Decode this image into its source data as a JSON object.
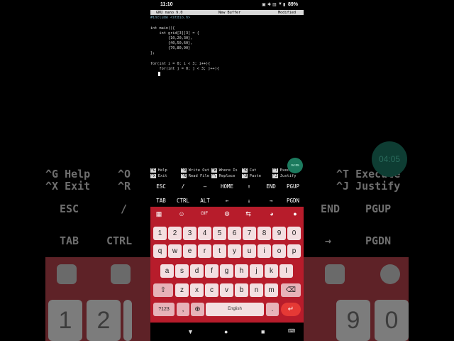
{
  "status": {
    "time": "11:10",
    "battery": "89%"
  },
  "nano": {
    "app": "GNU nano 9.0",
    "buffer": "New Buffer",
    "state": "Modified",
    "lines": [
      "#include <stdio.h>",
      "",
      "int main(){",
      "    int grid[3][3] = {",
      "        {10,20,30},",
      "        {40,50,60},",
      "        {70,80,90}",
      "};",
      "",
      "for(int i = 0; i < 3; i++){",
      "    for(int j = 0; j < 3; j++){"
    ],
    "shortcuts": [
      {
        "key": "^G",
        "label": "Help"
      },
      {
        "key": "^X",
        "label": "Exit"
      },
      {
        "key": "^O",
        "label": "Write Out"
      },
      {
        "key": "^R",
        "label": "Read File"
      },
      {
        "key": "^W",
        "label": "Where Is"
      },
      {
        "key": "^\\",
        "label": "Replace"
      },
      {
        "key": "^K",
        "label": "Cut"
      },
      {
        "key": "^U",
        "label": "Paste"
      },
      {
        "key": "^T",
        "label": "Execute"
      },
      {
        "key": "^J",
        "label": "Justify"
      }
    ]
  },
  "bubble": {
    "time": "04:05"
  },
  "extra_keys": {
    "row1": [
      "ESC",
      "/",
      "—",
      "HOME",
      "↑",
      "END",
      "PGUP"
    ],
    "row2": [
      "TAB",
      "CTRL",
      "ALT",
      "←",
      "↓",
      "→",
      "PGDN"
    ]
  },
  "keyboard": {
    "toolbar_gif": "GIF",
    "numbers": [
      "1",
      "2",
      "3",
      "4",
      "5",
      "6",
      "7",
      "8",
      "9",
      "0"
    ],
    "row1": [
      "q",
      "w",
      "e",
      "r",
      "t",
      "y",
      "u",
      "i",
      "o",
      "p"
    ],
    "row2": [
      "a",
      "s",
      "d",
      "f",
      "g",
      "h",
      "j",
      "k",
      "l"
    ],
    "row3": [
      "z",
      "x",
      "c",
      "v",
      "b",
      "n",
      "m"
    ],
    "sym": "?123",
    "comma": ",",
    "space": "English",
    "period": "."
  },
  "icons": {
    "apps": "apps-grid-icon",
    "sticker": "sticker-icon",
    "settings": "gear-icon",
    "translate": "translate-icon",
    "palette": "palette-icon",
    "mic": "mic-icon",
    "shift": "shift-icon",
    "backspace": "backspace-icon",
    "globe": "globe-icon",
    "enter": "enter-icon"
  },
  "colors": {
    "keyboard_bg": "#b71c2b",
    "key_bg": "#f3dfe1",
    "enter_key": "#e53935",
    "bubble": "#1c7a5e"
  }
}
